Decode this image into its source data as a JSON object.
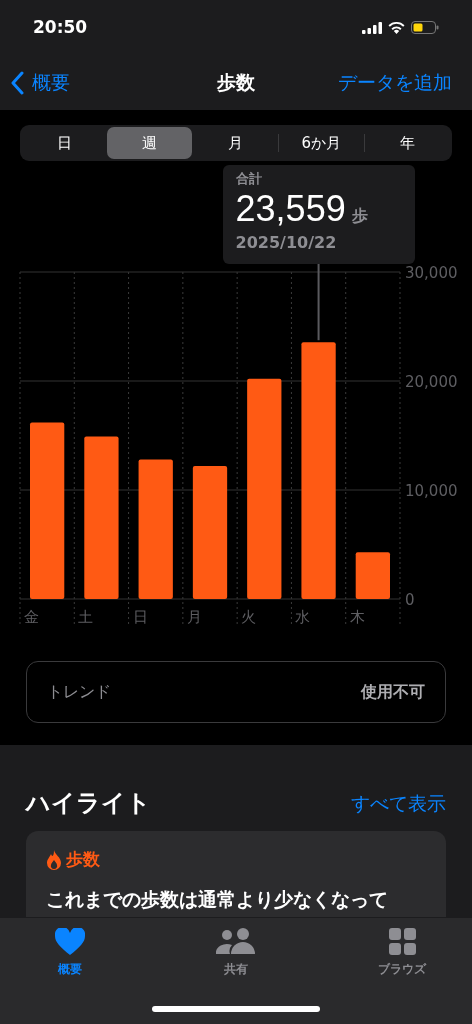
{
  "status_bar": {
    "time": "20:50"
  },
  "nav": {
    "back": "概要",
    "title": "歩数",
    "action": "データを追加"
  },
  "periods": [
    {
      "label": "日",
      "selected": false
    },
    {
      "label": "週",
      "selected": true
    },
    {
      "label": "月",
      "selected": false
    },
    {
      "label": "6か月",
      "selected": false
    },
    {
      "label": "年",
      "selected": false
    }
  ],
  "tooltip": {
    "label": "合計",
    "value": "23,559",
    "unit": "歩",
    "date": "2025/10/22"
  },
  "chart": {
    "chart_data": {
      "type": "bar",
      "categories": [
        "金",
        "土",
        "日",
        "月",
        "火",
        "水",
        "木"
      ],
      "series": [
        {
          "color": "#ff5a14",
          "values": [
            16200,
            14900,
            12800,
            12200,
            20200,
            23559,
            4300
          ]
        }
      ],
      "ylim": [
        0,
        30000
      ],
      "yticks": [
        {
          "value": 0,
          "label": "0"
        },
        {
          "value": 10000,
          "label": "10,000"
        },
        {
          "value": 20000,
          "label": "20,000"
        },
        {
          "value": 30000,
          "label": "30,000"
        }
      ]
    }
  },
  "trend": {
    "label": "トレンド",
    "value": "使用不可"
  },
  "highlights": {
    "title": "ハイライト",
    "action": "すべて表示",
    "card": {
      "category": "歩数",
      "text": "これまでの歩数は通常より少なくなって"
    }
  },
  "tab_bar": [
    {
      "label": "概要",
      "kind": "heart",
      "selected": true
    },
    {
      "label": "共有",
      "kind": "people",
      "selected": false
    },
    {
      "label": "ブラウズ",
      "kind": "grid",
      "selected": false
    }
  ]
}
